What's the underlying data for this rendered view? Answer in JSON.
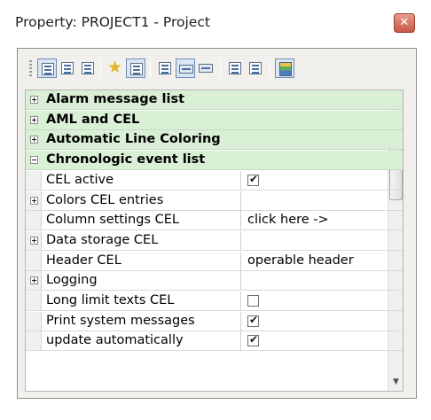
{
  "window": {
    "title": "Property: PROJECT1 - Project"
  },
  "toolbar": {
    "buttons": [
      {
        "icon": "categorized-view-icon",
        "active": true
      },
      {
        "icon": "alphabetic-view-icon"
      },
      {
        "icon": "properties-icon"
      },
      {
        "icon": "favorites-icon"
      },
      {
        "icon": "dynamic-icon",
        "active": true
      },
      {
        "icon": "text-icon"
      },
      {
        "icon": "combobox-icon",
        "active": true
      },
      {
        "icon": "entry-field-icon"
      },
      {
        "icon": "expand-all-icon"
      },
      {
        "icon": "collapse-all-icon"
      },
      {
        "icon": "color-palette-icon",
        "active": true
      }
    ]
  },
  "rows": [
    {
      "type": "category",
      "label": "Alarm message list",
      "expanded": false
    },
    {
      "type": "category",
      "label": "AML and CEL",
      "expanded": false
    },
    {
      "type": "category",
      "label": "Automatic Line Coloring",
      "expanded": false
    },
    {
      "type": "category",
      "label": "Chronologic event list",
      "expanded": true
    },
    {
      "type": "prop",
      "name": "CEL active",
      "value_kind": "checkbox",
      "checked": true
    },
    {
      "type": "prop",
      "name": "Colors CEL entries",
      "expandable": true,
      "value": ""
    },
    {
      "type": "prop",
      "name": "Column settings CEL",
      "value": "click here ->"
    },
    {
      "type": "prop",
      "name": "Data storage CEL",
      "expandable": true,
      "value": ""
    },
    {
      "type": "prop",
      "name": "Header CEL",
      "value": "operable header"
    },
    {
      "type": "prop",
      "name": "Logging",
      "expandable": true,
      "value": ""
    },
    {
      "type": "prop",
      "name": "Long limit texts CEL",
      "value_kind": "checkbox",
      "checked": false
    },
    {
      "type": "prop",
      "name": "Print system messages",
      "value_kind": "checkbox",
      "checked": true
    },
    {
      "type": "prop",
      "name": "update automatically",
      "value_kind": "checkbox",
      "checked": true
    }
  ],
  "scrollbar": {
    "up_icon": "scroll-up-arrow",
    "down_icon": "scroll-down-arrow",
    "position": 0.0
  }
}
